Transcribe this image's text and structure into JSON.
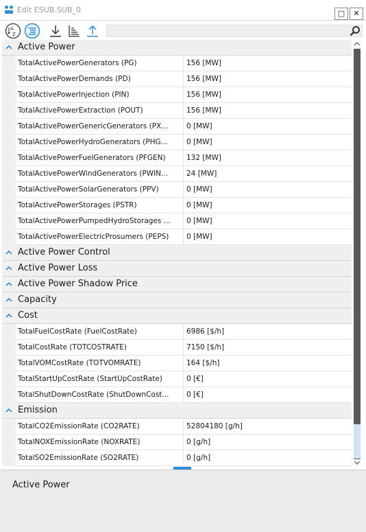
{
  "window": {
    "title": "Edit ESUB.SUB_0",
    "restore_label": "□",
    "close_label": "✕"
  },
  "toolbar": {
    "search_placeholder": "",
    "sort_alpha_icon": "sort-alpha-icon",
    "categorize_icon": "categorize-icon",
    "import_icon": "download-icon",
    "sort_icon": "sort-icon",
    "export_icon": "upload-icon"
  },
  "colors": {
    "accent": "#2d8fd6",
    "category_bg": "#f0f0f0",
    "description_bg": "#ebebeb"
  },
  "categories": [
    {
      "name": "Active Power",
      "expanded": true,
      "rows": [
        {
          "name": "TotalActivePowerGenerators (PG)",
          "value": "156 [MW]"
        },
        {
          "name": "TotalActivePowerDemands (PD)",
          "value": "156 [MW]"
        },
        {
          "name": "TotalActivePowerInjection (PIN)",
          "value": "156 [MW]"
        },
        {
          "name": "TotalActivePowerExtraction (POUT)",
          "value": "156 [MW]"
        },
        {
          "name": "TotalActivePowerGenericGenerators (PX...",
          "value": "0 [MW]"
        },
        {
          "name": "TotalActivePowerHydroGenerators (PHG...",
          "value": "0 [MW]"
        },
        {
          "name": "TotalActivePowerFuelGenerators (PFGEN)",
          "value": "132 [MW]"
        },
        {
          "name": "TotalActivePowerWindGenerators (PWIN...",
          "value": "24 [MW]"
        },
        {
          "name": "TotalActivePowerSolarGenerators (PPV)",
          "value": "0 [MW]"
        },
        {
          "name": "TotalActivePowerStorages (PSTR)",
          "value": "0 [MW]"
        },
        {
          "name": "TotalActivePowerPumpedHydroStorages ...",
          "value": "0 [MW]"
        },
        {
          "name": "TotalActivePowerElectricProsumers (PEPS)",
          "value": "0 [MW]"
        }
      ]
    },
    {
      "name": "Active Power Control",
      "expanded": false,
      "rows": []
    },
    {
      "name": "Active Power Loss",
      "expanded": false,
      "rows": []
    },
    {
      "name": "Active Power Shadow Price",
      "expanded": false,
      "rows": []
    },
    {
      "name": "Capacity",
      "expanded": false,
      "rows": []
    },
    {
      "name": "Cost",
      "expanded": true,
      "rows": [
        {
          "name": "TotalFuelCostRate (FuelCostRate)",
          "value": "6986 [$/h]"
        },
        {
          "name": "TotalCostRate (TOTCOSTRATE)",
          "value": "7150 [$/h]"
        },
        {
          "name": "TotalVOMCostRate (TOTVOMRATE)",
          "value": "164 [$/h]"
        },
        {
          "name": "TotalStartUpCostRate (StartUpCostRate)",
          "value": "0 [€]"
        },
        {
          "name": "TotalShutDownCostRate (ShutDownCost...",
          "value": "0 [€]"
        }
      ]
    },
    {
      "name": "Emission",
      "expanded": true,
      "rows": [
        {
          "name": "TotalCO2EmissionRate (CO2RATE)",
          "value": "52804180 [g/h]"
        },
        {
          "name": "TotalNOXEmissionRate (NOXRATE)",
          "value": "0 [g/h]"
        },
        {
          "name": "TotalSO2EmissionRate (SO2RATE)",
          "value": "0 [g/h]"
        }
      ]
    }
  ],
  "description": {
    "title": "Active Power"
  }
}
